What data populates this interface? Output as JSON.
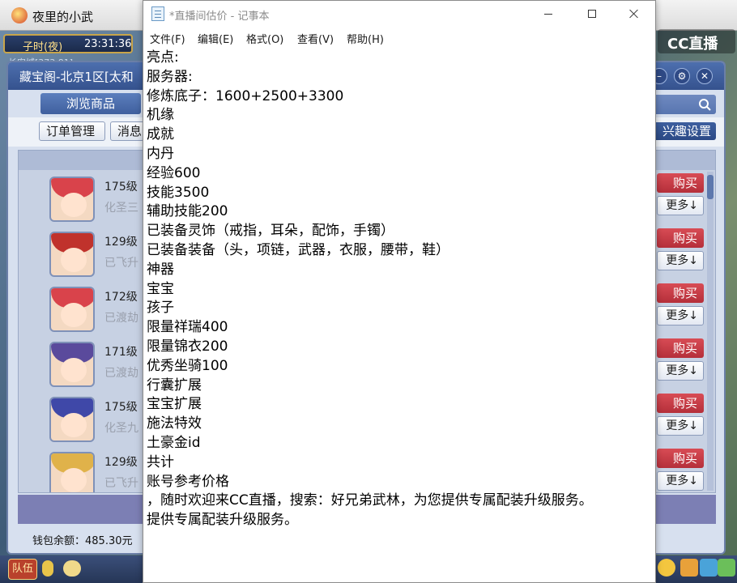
{
  "game": {
    "window_title": "夜里的小武",
    "time_period": "子时(夜)",
    "clock": "23:31:36",
    "location": "长安城[373,81]",
    "cc_logo": "CC直播",
    "shop": {
      "title": "藏宝阁-北京1区[太和",
      "browse_tab": "浏览商品",
      "toolbar": {
        "order_btn": "订单管理",
        "message_btn": "消息"
      },
      "interest_btn": "兴趣设置",
      "buy_label": "购买",
      "more_label": "更多↓",
      "rows": [
        {
          "level": "175级",
          "status": "化圣三",
          "hair": "#d9434b"
        },
        {
          "level": "129级",
          "status": "已飞升",
          "hair": "#c0322c"
        },
        {
          "level": "172级",
          "status": "已渡劫",
          "hair": "#d9434b"
        },
        {
          "level": "171级",
          "status": "已渡劫",
          "hair": "#5a4a9c"
        },
        {
          "level": "175级",
          "status": "化圣九",
          "hair": "#3f48a8"
        },
        {
          "level": "129级",
          "status": "已飞升",
          "hair": "#e0b24a"
        }
      ],
      "wallet": "钱包余额：485.30元"
    },
    "bottom": {
      "team_btn": "队伍"
    }
  },
  "notepad": {
    "title": "*直播间估价 - 记事本",
    "menu": [
      "文件(F)",
      "编辑(E)",
      "格式(O)",
      "查看(V)",
      "帮助(H)"
    ],
    "lines": [
      "亮点:",
      "服务器:",
      "修炼底子：1600+2500+3300",
      "机缘",
      "成就",
      "内丹",
      "经验600",
      "技能3500",
      "辅助技能200",
      "已装备灵饰（戒指，耳朵，配饰，手镯）",
      "已装备装备（头，项链，武器，衣服，腰带，鞋）",
      "神器",
      "宝宝",
      "孩子",
      "限量祥瑞400",
      "限量锦衣200",
      "优秀坐骑100",
      "行囊扩展",
      "宝宝扩展",
      "施法特效",
      "土豪金id",
      "共计",
      "账号参考价格",
      "，随时欢迎来CC直播，搜索：好兄弟武林，为您提供专属配装升级服务。",
      "提供专属配装升级服务。"
    ]
  },
  "colors": {
    "buy_red": "#c43a44",
    "shop_header_blue": "#3f5f9e",
    "notepad_bg": "#ffffff"
  }
}
